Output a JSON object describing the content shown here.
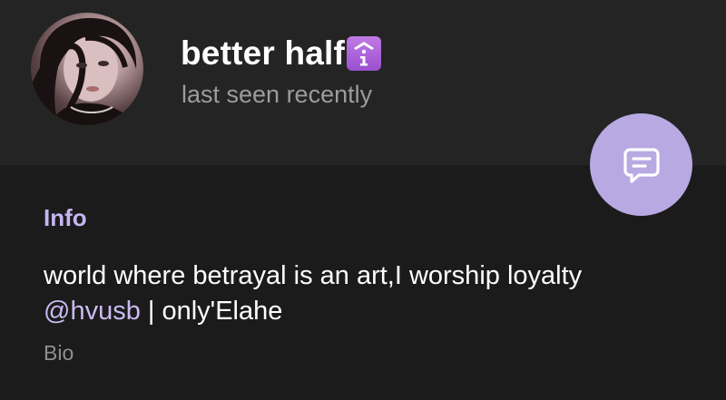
{
  "profile": {
    "name": "better half",
    "badge_icon": "info-symbol-icon",
    "status": "last seen recently"
  },
  "fab": {
    "icon": "message-bubble-icon"
  },
  "info": {
    "section_title": "Info",
    "bio_line1": "world where betrayal is an art,I worship loyalty",
    "bio_mention": "@hvusb",
    "bio_suffix": " | only'Elahe",
    "bio_label": "Bio"
  },
  "colors": {
    "header_bg": "#242424",
    "body_bg": "#1b1b1b",
    "accent": "#c4b6ef",
    "fab_bg": "#b8a9e3",
    "badge": "#a85cd8"
  }
}
